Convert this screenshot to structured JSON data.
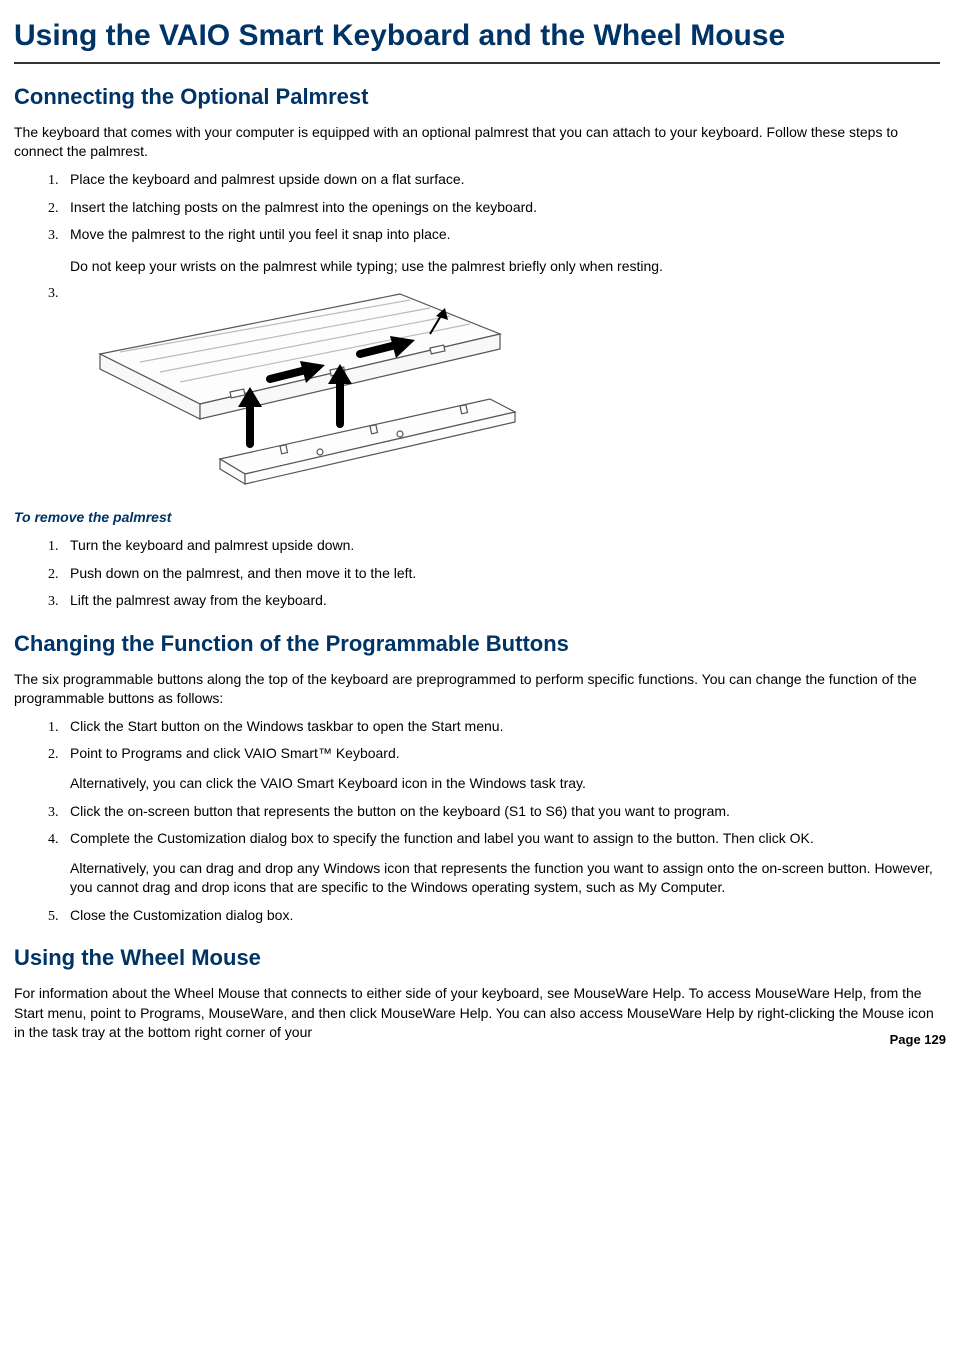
{
  "title": "Using the VAIO Smart Keyboard and the Wheel Mouse",
  "section1": {
    "heading": "Connecting the Optional Palmrest",
    "intro": "The keyboard that comes with your computer is equipped with an optional palmrest that you can attach to your keyboard. Follow these steps to connect the palmrest.",
    "steps": [
      "Place the keyboard and palmrest upside down on a flat surface.",
      "Insert the latching posts on the palmrest into the openings on the keyboard.",
      "Move the palmrest to the right until you feel it snap into place."
    ],
    "caution": "Do not keep your wrists on the palmrest while typing; use the palmrest briefly only when resting.",
    "remove_heading": "To remove the palmrest",
    "remove_steps": [
      "Turn the keyboard and palmrest upside down.",
      "Push down on the palmrest, and then move it to the left.",
      "Lift the palmrest away from the keyboard."
    ]
  },
  "section2": {
    "heading": "Changing the Function of the Programmable Buttons",
    "intro": "The six programmable buttons along the top of the keyboard are preprogrammed to perform specific functions. You can change the function of the programmable buttons as follows:",
    "steps": [
      "Click the Start button on the Windows taskbar to open the Start menu.",
      "Point to Programs and click VAIO Smart™ Keyboard.",
      "Click the on-screen button that represents the button on the keyboard (S1 to S6) that you want to program.",
      "Complete the Customization dialog box to specify the function and label you want to assign to the button. Then click OK.",
      "Close the Customization dialog box."
    ],
    "alt1": "Alternatively, you can click the VAIO Smart Keyboard icon in the Windows task tray.",
    "alt2": "Alternatively, you can drag and drop any Windows icon that represents the function you want to assign onto the on-screen button. However, you cannot drag and drop icons that are specific to the Windows operating system, such as My Computer."
  },
  "section3": {
    "heading": "Using the Wheel Mouse",
    "body": "For information about the Wheel Mouse that connects to either side of your keyboard, see MouseWare Help. To access MouseWare Help, from the Start menu, point to Programs, MouseWare, and then click MouseWare Help. You can also access MouseWare Help by right-clicking the Mouse icon in the task tray at the bottom right corner of your"
  },
  "page_number": "Page 129"
}
